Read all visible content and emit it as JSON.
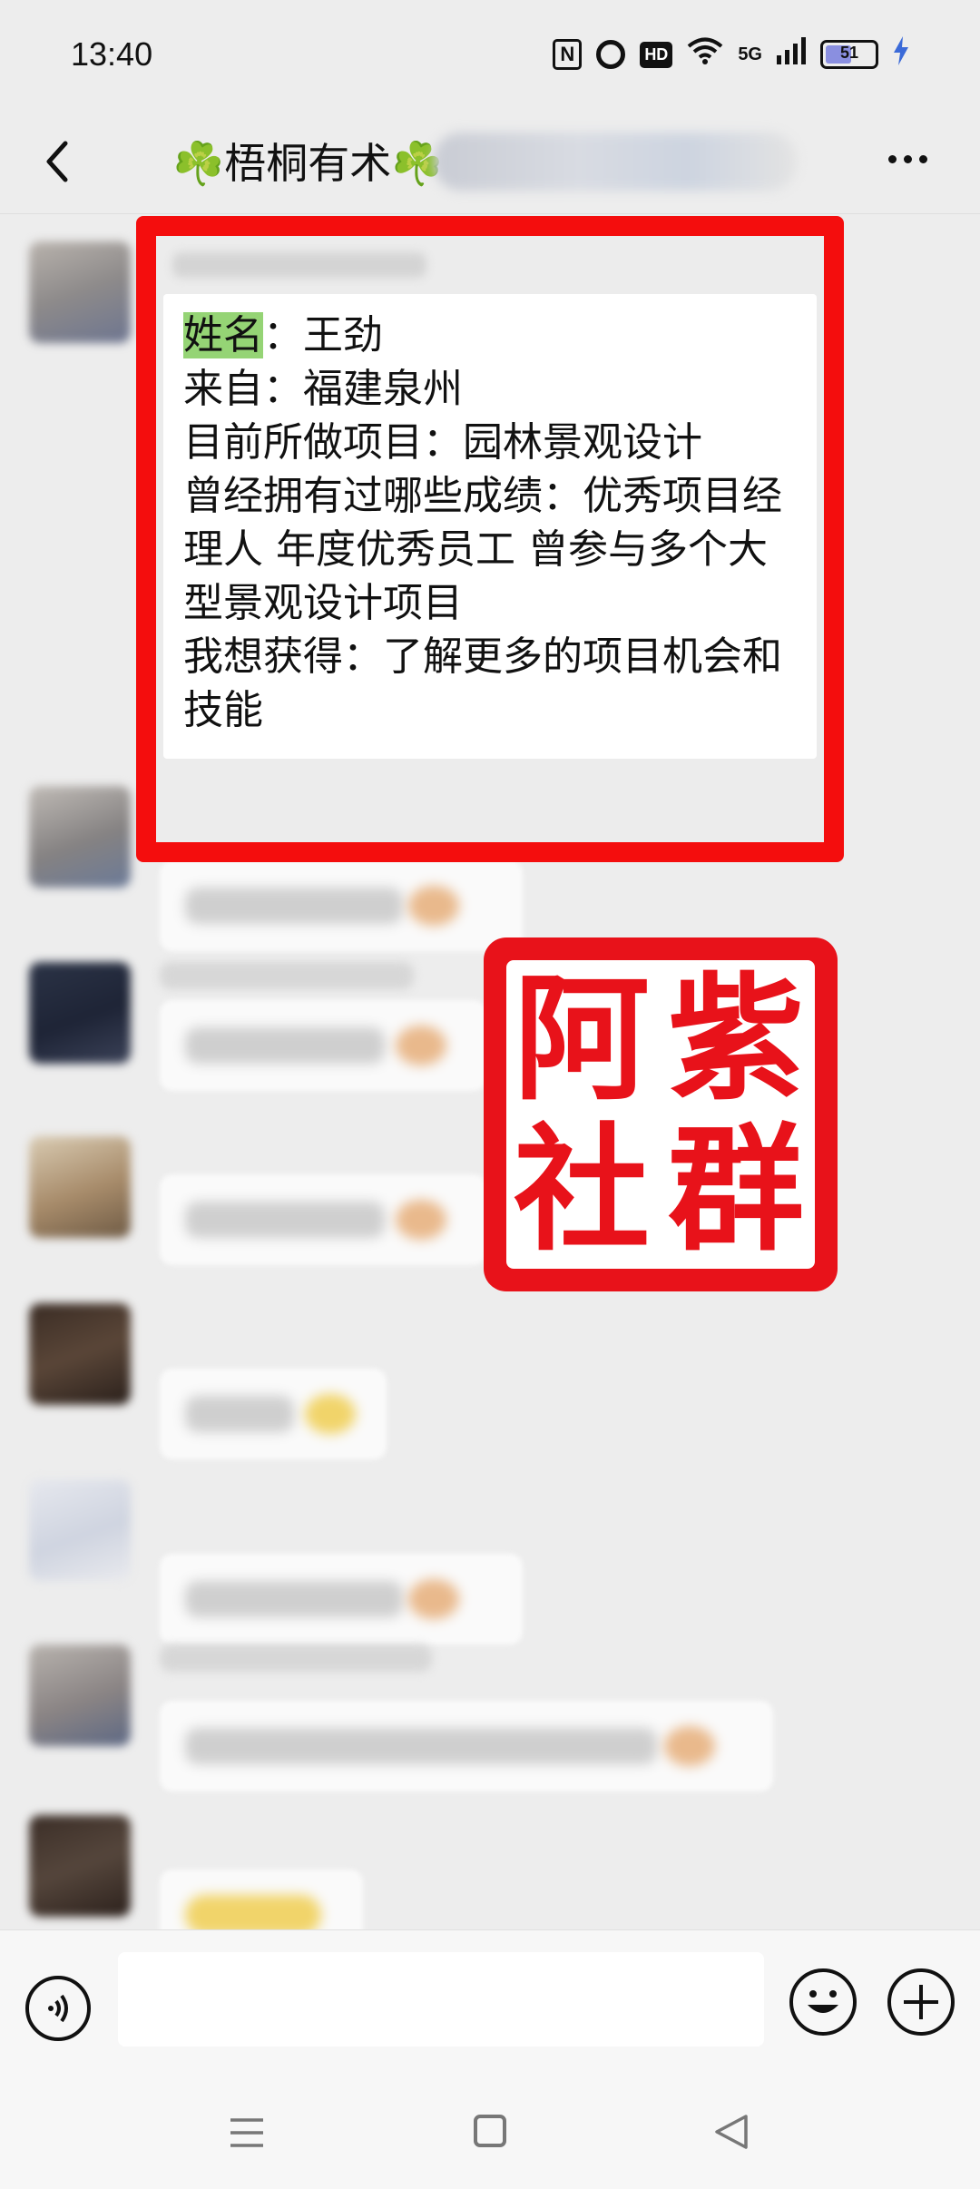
{
  "status_bar": {
    "time": "13:40",
    "icons": [
      "nfc-icon",
      "alarm-icon",
      "hd-icon",
      "wifi-icon",
      "5g-signal-icon",
      "battery-icon",
      "charging-icon"
    ],
    "nfc_label": "N",
    "hd_label": "HD",
    "network_label": "5G",
    "battery_level": "51"
  },
  "header": {
    "title": "☘️梧桐有术☘️",
    "back_icon": "chevron-left-icon",
    "more_icon": "more-dots-icon"
  },
  "highlighted_message": {
    "frame_color": "#f40d0d",
    "lines": [
      {
        "key": "姓名",
        "rest": "：王劲"
      },
      {
        "text": "来自：福建泉州"
      },
      {
        "text": "目前所做项目：园林景观设计"
      },
      {
        "text": "曾经拥有过哪些成绩：优秀项目经"
      },
      {
        "text": "理人 年度优秀员工 曾参与多个大"
      },
      {
        "text": "型景观设计项目"
      },
      {
        "text": "我想获得：了解更多的项目机会和"
      },
      {
        "text": "技能"
      }
    ]
  },
  "stamp": {
    "chars": [
      "阿",
      "紫",
      "社",
      "群"
    ],
    "color": "#e8121a"
  },
  "input_bar": {
    "placeholder": "",
    "voice_icon": "voice-icon",
    "emoji_icon": "emoji-smile-icon",
    "plus_icon": "plus-circle-icon"
  },
  "nav_bar": {
    "icons": [
      "menu-lines-icon",
      "home-square-icon",
      "back-triangle-icon"
    ]
  }
}
